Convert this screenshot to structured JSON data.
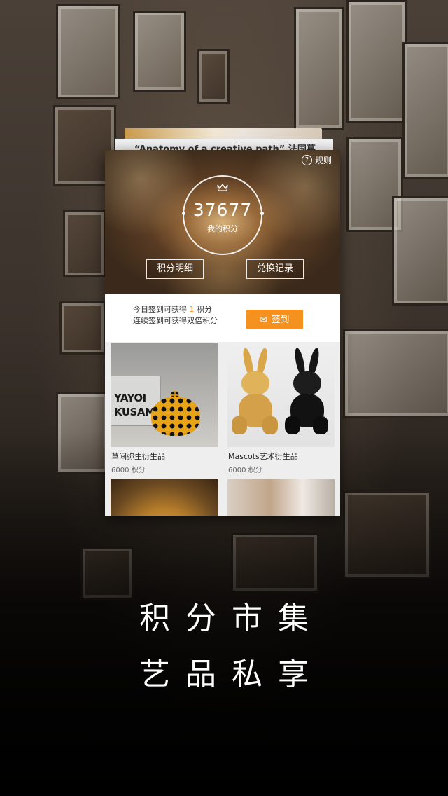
{
  "stack": {
    "card_title": "“Anatomy of a creative path” 法国慕"
  },
  "header": {
    "rules_icon": "help-circle-icon",
    "rules_label": "规则",
    "crown_icon": "crown-icon",
    "points_value": "37677",
    "points_label": "我的积分",
    "detail_button": "积分明细",
    "exchange_button": "兑换记录"
  },
  "checkin": {
    "line1_prefix": "今日签到可获得",
    "line1_points": "1",
    "line1_suffix": "积分",
    "line2": "连续签到可获得双倍积分",
    "button_icon": "calendar-icon",
    "button_label": "签到"
  },
  "products": [
    {
      "name": "草间弥生衍生品",
      "price": "6000 积分",
      "image_text_1": "YAYOI",
      "image_text_2": "KUSAMA"
    },
    {
      "name": "Mascots艺术衍生品",
      "price": "6000 积分"
    },
    {
      "name": "",
      "price": ""
    },
    {
      "name": "",
      "price": ""
    }
  ],
  "slogan": {
    "line1": "积分市集",
    "line2": "艺品私享"
  },
  "colors": {
    "accent": "#f5911e",
    "card_bg": "#f4f4f4"
  }
}
